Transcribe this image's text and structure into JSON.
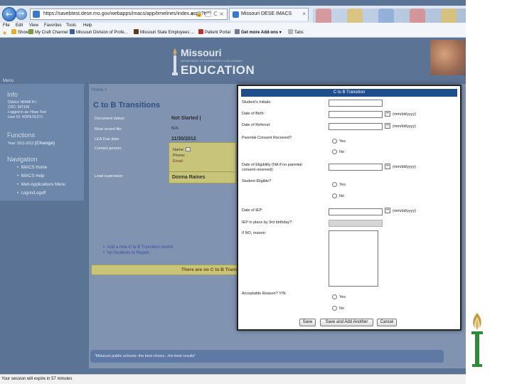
{
  "browser": {
    "url": "https://savebtest.dese.mo.gov/webapps/imacs/app/timelines/index.aspx?t",
    "url_tools": "▾ 🔒 🗂 C ×",
    "tab_title": "Missouri DESE IMACS",
    "tab_close": "×",
    "back_glyph": "←",
    "forward_glyph": "→",
    "menu": [
      "File",
      "Edit",
      "View",
      "Favorites",
      "Tools",
      "Help"
    ],
    "favorites": [
      {
        "label": "Shows",
        "icon_color": "#e5b021"
      },
      {
        "label": "My Craft Channel",
        "icon_color": "#7a9a3b"
      },
      {
        "label": "Missouri Division of Profe...",
        "icon_color": "#3a5f9c"
      },
      {
        "label": "Missouri State Employees ...",
        "icon_color": "#5d3b14"
      },
      {
        "label": "Patient Portal",
        "icon_color": "#c03030"
      },
      {
        "label": "Get more Add-ons ▾",
        "icon_color": "#6b7c93"
      },
      {
        "label": "Tabs",
        "icon_color": "#b5b5b5"
      }
    ],
    "status": "Your session will expire in 57 minutes"
  },
  "site": {
    "logo_top": "Missouri",
    "logo_dept": "DEPARTMENT OF ELEMENTARY & SECONDARY",
    "logo_bottom": "EDUCATION",
    "menu_label": "Menu",
    "info": {
      "heading": "Info",
      "lines": [
        "District: MIAMI R-I",
        "CDC: 097105",
        "Logged in as: Hope Test",
        "User ID: HOPETEST1"
      ]
    },
    "functions": {
      "heading": "Functions",
      "year_prefix": "Year: 2011-2012",
      "change_label": "(Change)"
    },
    "navigation": {
      "heading": "Navigation",
      "items": [
        "IMACS Home",
        "IMACS Help",
        "Web Applications Menu",
        "Logon/Logoff"
      ]
    },
    "main": {
      "breadcrumb": "Home >",
      "title": "C to B Transitions",
      "fields": [
        {
          "label": "Document status:",
          "value": "Not Started |"
        },
        {
          "label": "Most recent file:",
          "value": "N/A"
        },
        {
          "label": "LEA Due date:",
          "value": "11/30/2012"
        }
      ],
      "contact_label": "Contact person:",
      "contact_lines": [
        "Name:",
        "Phone:",
        "Email:"
      ],
      "supervisor_label": "Lead supervisor:",
      "supervisor_value": "Donna Raines",
      "links": [
        "Add a new C to B Transition record",
        "No Students to Report"
      ],
      "empty_message": "There are no C to B Transitions",
      "footer_text": "\"Missouri public schools: the best choice...the best results\""
    }
  },
  "modal": {
    "title": "C to B Transition",
    "date_format": "(mm/dd/yyyy)",
    "fields": {
      "initials": "Student's Initials:",
      "dob": "Date of Birth:",
      "referral": "Date of Referral:",
      "consent": "Parental Consent Received?",
      "eligibility_l1": "Date of Eligibility (NA if no parental",
      "eligibility_l2": "consent received):",
      "eligible": "Student Eligible?",
      "iep": "Date of IEP:",
      "iep_by_3": "IEP in place by 3rd birthday?:",
      "reason": "If NO, reason:",
      "acceptable": "Acceptable Reason? Y/N:"
    },
    "yes": "Yes",
    "no": "No",
    "buttons": {
      "save": "Save",
      "save_add": "Save and Add Another",
      "cancel": "Cancel"
    }
  }
}
